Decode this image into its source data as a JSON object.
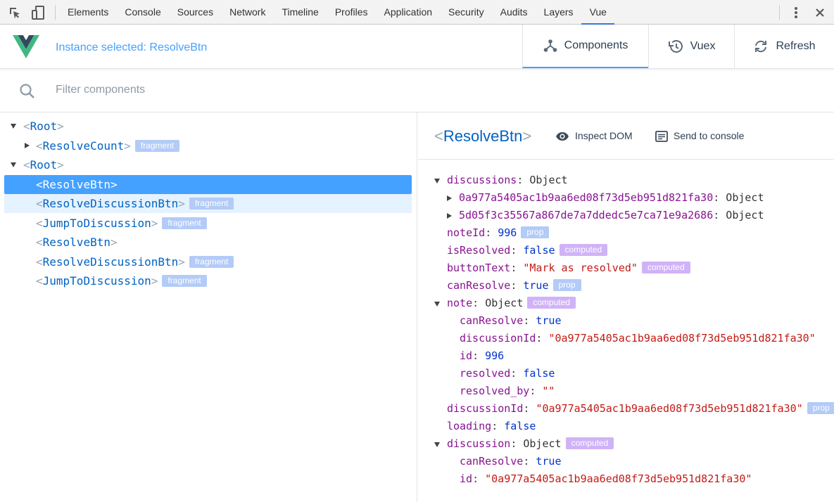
{
  "devtools": {
    "tabs": [
      "Elements",
      "Console",
      "Sources",
      "Network",
      "Timeline",
      "Profiles",
      "Application",
      "Security",
      "Audits",
      "Layers",
      "Vue"
    ],
    "active_tab": "Vue"
  },
  "header": {
    "instance_message": "Instance selected: ResolveBtn",
    "buttons": {
      "components": "Components",
      "vuex": "Vuex",
      "refresh": "Refresh"
    },
    "accent_color": "#44a1ff"
  },
  "search": {
    "placeholder": "Filter components",
    "value": ""
  },
  "tree": [
    {
      "lt": "<",
      "name": "Root",
      "gt": ">",
      "tag": ""
    },
    {
      "lt": "<",
      "name": "ResolveCount",
      "gt": ">",
      "tag": "fragment"
    },
    {
      "lt": "<",
      "name": "Root",
      "gt": ">",
      "tag": ""
    },
    {
      "lt": "<",
      "name": "ResolveBtn",
      "gt": ">",
      "tag": ""
    },
    {
      "lt": "<",
      "name": "ResolveDiscussionBtn",
      "gt": ">",
      "tag": "fragment"
    },
    {
      "lt": "<",
      "name": "JumpToDiscussion",
      "gt": ">",
      "tag": "fragment"
    },
    {
      "lt": "<",
      "name": "ResolveBtn",
      "gt": ">",
      "tag": ""
    },
    {
      "lt": "<",
      "name": "ResolveDiscussionBtn",
      "gt": ">",
      "tag": "fragment"
    },
    {
      "lt": "<",
      "name": "JumpToDiscussion",
      "gt": ">",
      "tag": "fragment"
    }
  ],
  "inspector": {
    "lt": "<",
    "title": "ResolveBtn",
    "gt": ">",
    "inspect_dom": "Inspect DOM",
    "send_to_console": "Send to console",
    "colon": ":",
    "rows": [
      {
        "key": "discussions",
        "value": "Object",
        "tag": ""
      },
      {
        "key": "0a977a5405ac1b9aa6ed08f73d5eb951d821fa30",
        "value": "Object",
        "tag": ""
      },
      {
        "key": "5d05f3c35567a867de7a7ddedc5e7ca71e9a2686",
        "value": "Object",
        "tag": ""
      },
      {
        "key": "noteId",
        "value": "996",
        "tag": "prop"
      },
      {
        "key": "isResolved",
        "value": "false",
        "tag": "computed"
      },
      {
        "key": "buttonText",
        "value": "\"Mark as resolved\"",
        "tag": "computed"
      },
      {
        "key": "canResolve",
        "value": "true",
        "tag": "prop"
      },
      {
        "key": "note",
        "value": "Object",
        "tag": "computed"
      },
      {
        "key": "canResolve",
        "value": "true",
        "tag": ""
      },
      {
        "key": "discussionId",
        "value": "\"0a977a5405ac1b9aa6ed08f73d5eb951d821fa30\"",
        "tag": ""
      },
      {
        "key": "id",
        "value": "996",
        "tag": ""
      },
      {
        "key": "resolved",
        "value": "false",
        "tag": ""
      },
      {
        "key": "resolved_by",
        "value": "\"\"",
        "tag": ""
      },
      {
        "key": "discussionId",
        "value": "\"0a977a5405ac1b9aa6ed08f73d5eb951d821fa30\"",
        "tag": "prop"
      },
      {
        "key": "loading",
        "value": "false",
        "tag": ""
      },
      {
        "key": "discussion",
        "value": "Object",
        "tag": "computed"
      },
      {
        "key": "canResolve",
        "value": "true",
        "tag": ""
      },
      {
        "key": "id",
        "value": "\"0a977a5405ac1b9aa6ed08f73d5eb951d821fa30\"",
        "tag": ""
      }
    ]
  }
}
